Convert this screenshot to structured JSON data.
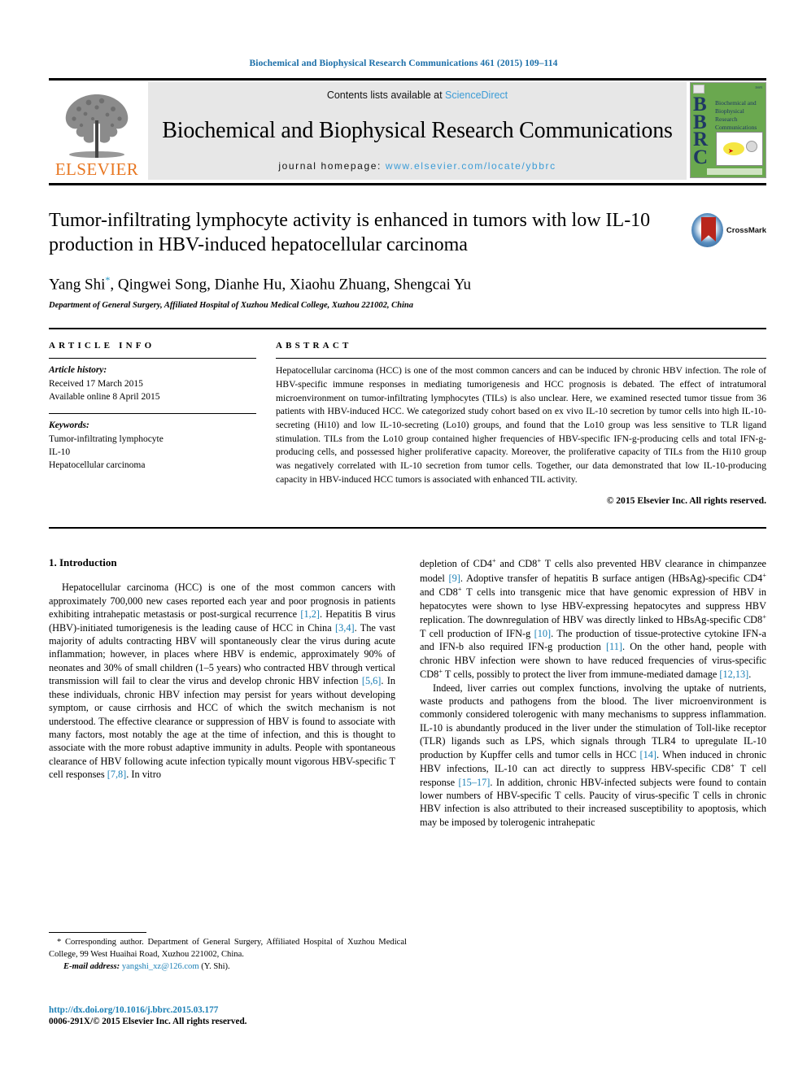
{
  "running_head": "Biochemical and Biophysical Research Communications 461 (2015) 109–114",
  "masthead": {
    "contents_prefix": "Contents lists available at ",
    "sciencedirect": "ScienceDirect",
    "journal_title": "Biochemical and Biophysical Research Communications",
    "homepage_label": "journal homepage:",
    "homepage_url": "www.elsevier.com/locate/ybbrc",
    "publisher_logo_text": "ELSEVIER",
    "cover": {
      "acronym": "BBRC",
      "title_lines": "Biochemical and Biophysical Research Communications"
    },
    "colors": {
      "link": "#3c9cd6",
      "elsevier_orange": "#E87722",
      "cover_green": "#6aa84f",
      "running_head_blue": "#1a6ea8"
    }
  },
  "article": {
    "title": "Tumor-infiltrating lymphocyte activity is enhanced in tumors with low IL-10 production in HBV-induced hepatocellular carcinoma",
    "authors": "Yang Shi",
    "authors_rest": ", Qingwei Song, Dianhe Hu, Xiaohu Zhuang, Shengcai Yu",
    "corresponding_marker": "*",
    "affiliation": "Department of General Surgery, Affiliated Hospital of Xuzhou Medical College, Xuzhou 221002, China",
    "crossmark_label": "CrossMark"
  },
  "info": {
    "heading": "ARTICLE INFO",
    "history_label": "Article history:",
    "received": "Received 17 March 2015",
    "available_online": "Available online 8 April 2015",
    "keywords_label": "Keywords:",
    "keywords": [
      "Tumor-infiltrating lymphocyte",
      "IL-10",
      "Hepatocellular carcinoma"
    ]
  },
  "abstract": {
    "heading": "ABSTRACT",
    "text": "Hepatocellular carcinoma (HCC) is one of the most common cancers and can be induced by chronic HBV infection. The role of HBV-specific immune responses in mediating tumorigenesis and HCC prognosis is debated. The effect of intratumoral microenvironment on tumor-infiltrating lymphocytes (TILs) is also unclear. Here, we examined resected tumor tissue from 36 patients with HBV-induced HCC. We categorized study cohort based on ex vivo IL-10 secretion by tumor cells into high IL-10-secreting (Hi10) and low IL-10-secreting (Lo10) groups, and found that the Lo10 group was less sensitive to TLR ligand stimulation. TILs from the Lo10 group contained higher frequencies of HBV-specific IFN-g-producing cells and total IFN-g-producing cells, and possessed higher proliferative capacity. Moreover, the proliferative capacity of TILs from the Hi10 group was negatively correlated with IL-10 secretion from tumor cells. Together, our data demonstrated that low IL-10-producing capacity in HBV-induced HCC tumors is associated with enhanced TIL activity.",
    "copyright": "© 2015 Elsevier Inc. All rights reserved."
  },
  "body": {
    "section_number_title": "1. Introduction",
    "left_paragraphs": [
      "Hepatocellular carcinoma (HCC) is one of the most common cancers with approximately 700,000 new cases reported each year and poor prognosis in patients exhibiting intrahepatic metastasis or post-surgical recurrence [1,2]. Hepatitis B virus (HBV)-initiated tumorigenesis is the leading cause of HCC in China [3,4]. The vast majority of adults contracting HBV will spontaneously clear the virus during acute inflammation; however, in places where HBV is endemic, approximately 90% of neonates and 30% of small children (1–5 years) who contracted HBV through vertical transmission will fail to clear the virus and develop chronic HBV infection [5,6]. In these individuals, chronic HBV infection may persist for years without developing symptom, or cause cirrhosis and HCC of which the switch mechanism is not understood. The effective clearance or suppression of HBV is found to associate with many factors, most notably the age at the time of infection, and this is thought to associate with the more robust adaptive immunity in adults. People with spontaneous clearance of HBV following acute infection typically mount vigorous HBV-specific T cell responses [7,8]. In vitro"
    ],
    "right_paragraphs": [
      "depletion of CD4+ and CD8+ T cells also prevented HBV clearance in chimpanzee model [9]. Adoptive transfer of hepatitis B surface antigen (HBsAg)-specific CD4+ and CD8+ T cells into transgenic mice that have genomic expression of HBV in hepatocytes were shown to lyse HBV-expressing hepatocytes and suppress HBV replication. The downregulation of HBV was directly linked to HBsAg-specific CD8+ T cell production of IFN-g [10]. The production of tissue-protective cytokine IFN-a and IFN-b also required IFN-g production [11]. On the other hand, people with chronic HBV infection were shown to have reduced frequencies of virus-specific CD8+ T cells, possibly to protect the liver from immune-mediated damage [12,13].",
      "Indeed, liver carries out complex functions, involving the uptake of nutrients, waste products and pathogens from the blood. The liver microenvironment is commonly considered tolerogenic with many mechanisms to suppress inflammation. IL-10 is abundantly produced in the liver under the stimulation of Toll-like receptor (TLR) ligands such as LPS, which signals through TLR4 to upregulate IL-10 production by Kupffer cells and tumor cells in HCC [14]. When induced in chronic HBV infections, IL-10 can act directly to suppress HBV-specific CD8+ T cell response [15–17]. In addition, chronic HBV-infected subjects were found to contain lower numbers of HBV-specific T cells. Paucity of virus-specific T cells in chronic HBV infection is also attributed to their increased susceptibility to apoptosis, which may be imposed by tolerogenic intrahepatic"
    ]
  },
  "footer": {
    "corresponding_note": "* Corresponding author. Department of General Surgery, Affiliated Hospital of Xuzhou Medical College, 99 West Huaihai Road, Xuzhou 221002, China.",
    "email_label": "E-mail address:",
    "email": "yangshi_xz@126.com",
    "email_suffix": "(Y. Shi).",
    "doi": "http://dx.doi.org/10.1016/j.bbrc.2015.03.177",
    "issn_line": "0006-291X/© 2015 Elsevier Inc. All rights reserved."
  }
}
